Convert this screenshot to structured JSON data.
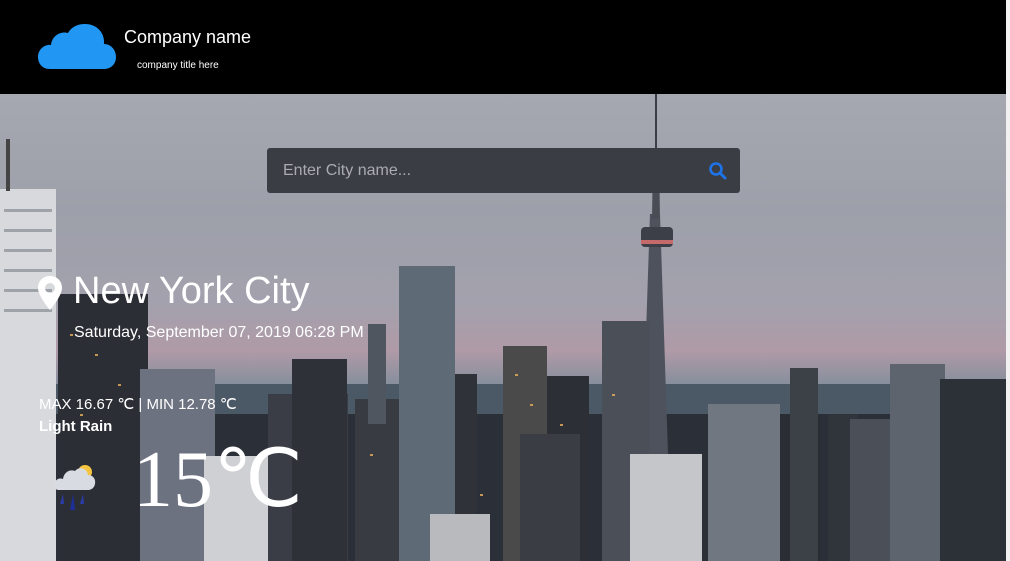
{
  "header": {
    "logo_icon": "cloud-icon",
    "company_name": "Company name",
    "company_title": "company title here"
  },
  "search": {
    "placeholder": "Enter City name...",
    "icon": "search-icon"
  },
  "weather": {
    "location_icon": "map-pin-icon",
    "city": "New York City",
    "datetime": "Saturday, September 07, 2019 06:28 PM",
    "minmax": "MAX 16.67 ℃ | MIN 12.78 ℃",
    "description": "Light Rain",
    "condition_icon": "rain-cloud-icon",
    "temperature": "15℃"
  },
  "colors": {
    "header_bg": "#000000",
    "search_bg": "#3a3d44",
    "search_icon": "#1e73e8",
    "logo_cloud": "#2196f3"
  }
}
